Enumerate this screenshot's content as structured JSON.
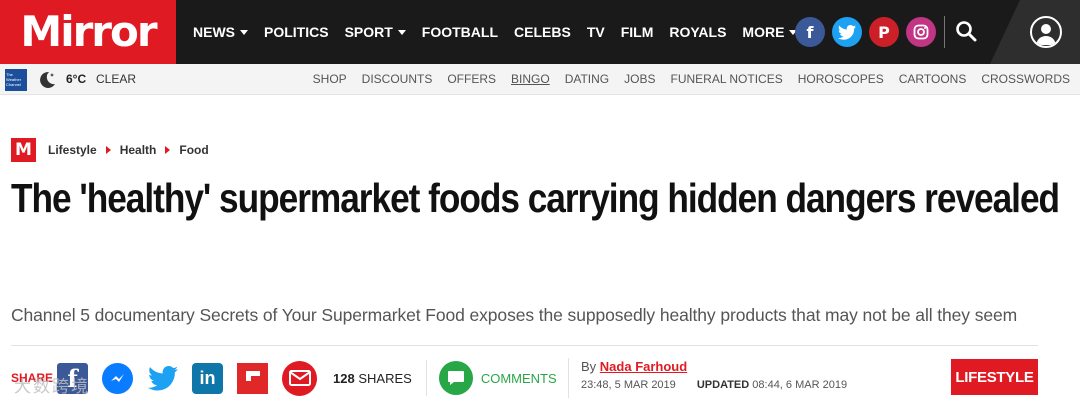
{
  "header": {
    "logo": "Mirror",
    "nav": [
      {
        "label": "NEWS",
        "dropdown": true
      },
      {
        "label": "POLITICS",
        "dropdown": false
      },
      {
        "label": "SPORT",
        "dropdown": true
      },
      {
        "label": "FOOTBALL",
        "dropdown": false
      },
      {
        "label": "CELEBS",
        "dropdown": false
      },
      {
        "label": "TV",
        "dropdown": false
      },
      {
        "label": "FILM",
        "dropdown": false
      },
      {
        "label": "ROYALS",
        "dropdown": false
      },
      {
        "label": "MORE",
        "dropdown": true
      }
    ],
    "social_icons": [
      "facebook-icon",
      "twitter-icon",
      "pinterest-icon",
      "instagram-icon"
    ],
    "colors": {
      "brand": "#e01a22",
      "bar": "#1a1a1a"
    }
  },
  "subbar": {
    "weather_logo": "The Weather Channel",
    "temperature": "6°C",
    "condition": "CLEAR",
    "links": [
      "SHOP",
      "DISCOUNTS",
      "OFFERS",
      "BINGO",
      "DATING",
      "JOBS",
      "FUNERAL NOTICES",
      "HOROSCOPES",
      "CARTOONS",
      "CROSSWORDS"
    ]
  },
  "article": {
    "badge": "M",
    "breadcrumb": [
      "Lifestyle",
      "Health",
      "Food"
    ],
    "headline": "The 'healthy' supermarket foods carrying hidden dangers revealed",
    "standfirst": "Channel 5 documentary Secrets of Your Supermarket Food exposes the supposedly healthy products that may not be all they seem",
    "share": {
      "label": "SHARE",
      "count": "128",
      "count_suffix": "SHARES",
      "comments_label": "COMMENTS"
    },
    "byline": {
      "prefix": "By",
      "author": "Nada Farhoud"
    },
    "published": "23:48, 5 MAR 2019",
    "updated_label": "UPDATED",
    "updated": "08:44, 6 MAR 2019",
    "section": "LIFESTYLE"
  },
  "watermark": {
    "text": "大数跨境"
  }
}
